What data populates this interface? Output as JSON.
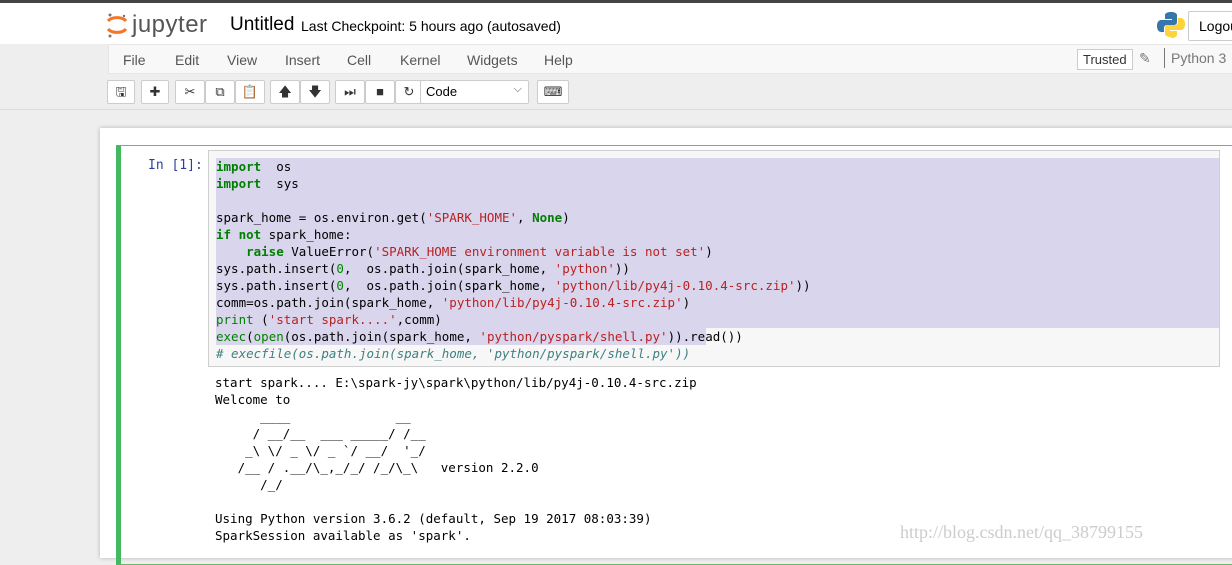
{
  "header": {
    "logo_text": "jupyter",
    "title": "Untitled",
    "checkpoint": "Last Checkpoint: 5 hours ago (autosaved)",
    "logout": "Logout"
  },
  "menu": [
    "File",
    "Edit",
    "View",
    "Insert",
    "Cell",
    "Kernel",
    "Widgets",
    "Help"
  ],
  "status": {
    "trusted": "Trusted",
    "kernel": "Python 3"
  },
  "toolbar": {
    "buttons": [
      {
        "name": "save-button",
        "icon": "save-icon",
        "glyph": "🖫"
      },
      {
        "name": "insert-cell-button",
        "icon": "plus-icon",
        "glyph": "✚"
      },
      {
        "name": "cut-button",
        "icon": "scissors-icon",
        "glyph": "✂"
      },
      {
        "name": "copy-button",
        "icon": "copy-icon",
        "glyph": "⧉"
      },
      {
        "name": "paste-button",
        "icon": "paste-icon",
        "glyph": "📋"
      },
      {
        "name": "move-up-button",
        "icon": "arrow-up-icon",
        "glyph": "🡅"
      },
      {
        "name": "move-down-button",
        "icon": "arrow-down-icon",
        "glyph": "🡇"
      },
      {
        "name": "run-button",
        "icon": "step-forward-icon",
        "glyph": "⏭"
      },
      {
        "name": "interrupt-button",
        "icon": "stop-icon",
        "glyph": "■"
      },
      {
        "name": "restart-button",
        "icon": "refresh-icon",
        "glyph": "↻"
      },
      {
        "name": "keyboard-button",
        "icon": "keyboard-icon",
        "glyph": "⌨"
      }
    ],
    "cell_type": "Code"
  },
  "cell": {
    "prompt": "In  [1]:",
    "code": [
      [
        [
          "kw",
          "import"
        ],
        [
          "",
          "  os"
        ]
      ],
      [
        [
          "kw",
          "import"
        ],
        [
          "",
          "  sys"
        ]
      ],
      [],
      [
        [
          "",
          "spark_home = os.environ.get("
        ],
        [
          "str",
          "'SPARK_HOME'"
        ],
        [
          "",
          ", "
        ],
        [
          "kw",
          "None"
        ],
        [
          "",
          ")"
        ]
      ],
      [
        [
          "kw",
          "if not"
        ],
        [
          "",
          " spark_home:"
        ]
      ],
      [
        [
          "",
          "    "
        ],
        [
          "kw",
          "raise"
        ],
        [
          "",
          " ValueError("
        ],
        [
          "str",
          "'SPARK_HOME environment variable is not set'"
        ],
        [
          "",
          ")"
        ]
      ],
      [
        [
          "",
          "sys.path.insert("
        ],
        [
          "num",
          "0"
        ],
        [
          "",
          ",  os.path.join(spark_home, "
        ],
        [
          "str",
          "'python'"
        ],
        [
          "",
          "))"
        ]
      ],
      [
        [
          "",
          "sys.path.insert("
        ],
        [
          "num",
          "0"
        ],
        [
          "",
          ",  os.path.join(spark_home, "
        ],
        [
          "str",
          "'python/lib/py4j-0.10.4-src.zip'"
        ],
        [
          "",
          "))"
        ]
      ],
      [
        [
          "",
          "comm=os.path.join(spark_home, "
        ],
        [
          "str",
          "'python/lib/py4j-0.10.4-src.zip'"
        ],
        [
          "",
          ")"
        ]
      ],
      [
        [
          "fn",
          "print"
        ],
        [
          "",
          " ("
        ],
        [
          "str",
          "'start spark....'"
        ],
        [
          "",
          ",comm)"
        ]
      ],
      [
        [
          "fn",
          "exec"
        ],
        [
          "",
          "("
        ],
        [
          "fn",
          "open"
        ],
        [
          "",
          "(os.path.join(spark_home, "
        ],
        [
          "str",
          "'python/pyspark/shell.py'"
        ],
        [
          "",
          ")).read())"
        ]
      ],
      [
        [
          "cm",
          "# execfile(os.path.join(spark_home, 'python/pyspark/shell.py'))"
        ]
      ]
    ],
    "output": "start spark.... E:\\spark-jy\\spark\\python/lib/py4j-0.10.4-src.zip\nWelcome to\n      ____              __\n     / __/__  ___ _____/ /__\n    _\\ \\/ _ \\/ _ `/ __/  '_/\n   /__ / .__/\\_,_/_/ /_/\\_\\   version 2.2.0\n      /_/\n\nUsing Python version 3.6.2 (default, Sep 19 2017 08:03:39)\nSparkSession available as 'spark'."
  },
  "watermark": "http://blog.csdn.net/qq_38799155",
  "colors": {
    "accent_green": "#42b861",
    "prompt_blue": "#303f9f",
    "selection": "#d9d5ec"
  }
}
